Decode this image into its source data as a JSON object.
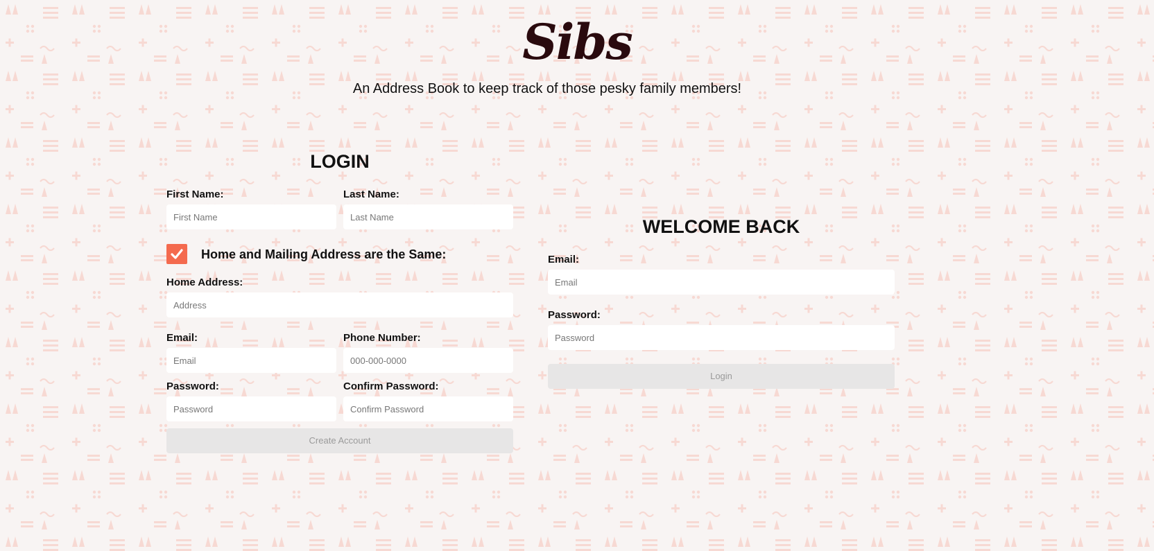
{
  "app": {
    "logo": "Sibs",
    "tagline": "An Address Book to keep track of those pesky family members!"
  },
  "signup": {
    "title": "LOGIN",
    "first_name": {
      "label": "First Name:",
      "placeholder": "First Name"
    },
    "last_name": {
      "label": "Last Name:",
      "placeholder": "Last Name"
    },
    "same_address": {
      "label": "Home and Mailing Address are the Same:",
      "checked": true
    },
    "home_address": {
      "label": "Home Address:",
      "placeholder": "Address"
    },
    "email": {
      "label": "Email:",
      "placeholder": "Email"
    },
    "phone": {
      "label": "Phone Number:",
      "placeholder": "000-000-0000"
    },
    "password": {
      "label": "Password:",
      "placeholder": "Password"
    },
    "confirm_password": {
      "label": "Confirm Password:",
      "placeholder": "Confirm Password"
    },
    "submit_label": "Create Account"
  },
  "login": {
    "title": "WELCOME BACK",
    "email": {
      "label": "Email:",
      "placeholder": "Email"
    },
    "password": {
      "label": "Password:",
      "placeholder": "Password"
    },
    "submit_label": "Login"
  },
  "colors": {
    "background": "#f8f4f3",
    "pattern": "#f7d9d3",
    "accent": "#f46a4e",
    "logo": "#2a0a0e",
    "button_bg": "#e7e6e6",
    "button_text": "#9a9a9a"
  },
  "icons": {
    "checkbox": "checkmark-icon"
  }
}
